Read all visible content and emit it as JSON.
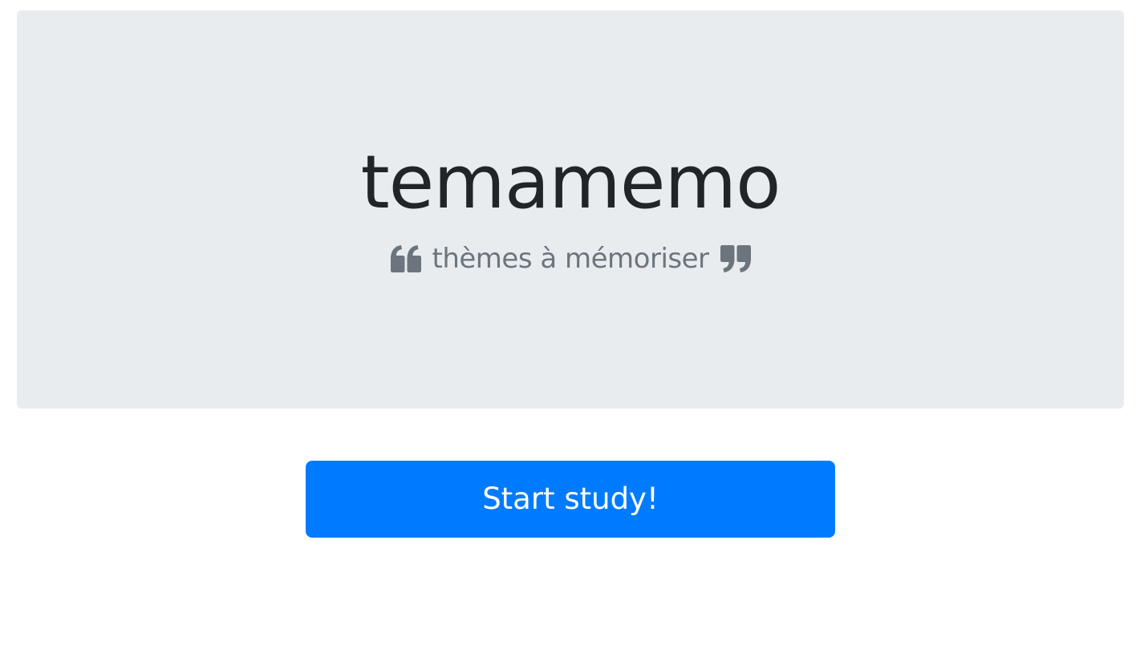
{
  "hero": {
    "title": "temamemo",
    "subtitle": "thèmes à mémoriser",
    "left_icon": "quote-left-icon",
    "right_icon": "quote-right-icon",
    "background_color": "#e9ecef",
    "text_color": "#212529",
    "muted_color": "#6c757d"
  },
  "actions": {
    "start_label": "Start study!",
    "button_color": "#007bff"
  }
}
